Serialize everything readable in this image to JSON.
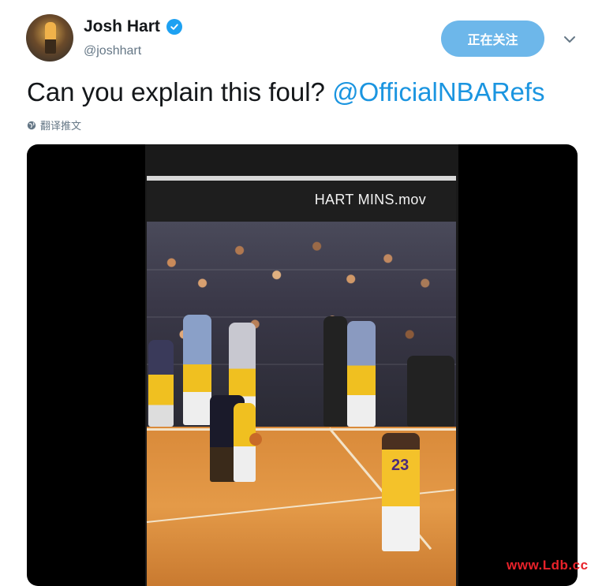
{
  "user": {
    "display_name": "Josh Hart",
    "handle": "@joshhart",
    "verified": true
  },
  "follow_button": {
    "label": "正在关注"
  },
  "tweet": {
    "text": "Can you explain this foul?",
    "mention": "@OfficialNBARefs",
    "translate_label": "翻译推文"
  },
  "media": {
    "video_title": "HART MINS.mov",
    "jersey_number": "23"
  },
  "watermark": "www.Ldb.cc",
  "colors": {
    "accent": "#1da1f2",
    "mention": "#1b95e0",
    "follow_button": "#6db7ea",
    "watermark": "#e8222a"
  },
  "icons": {
    "verified": "verified-badge-icon",
    "caret": "chevron-down-icon",
    "globe": "globe-icon"
  }
}
